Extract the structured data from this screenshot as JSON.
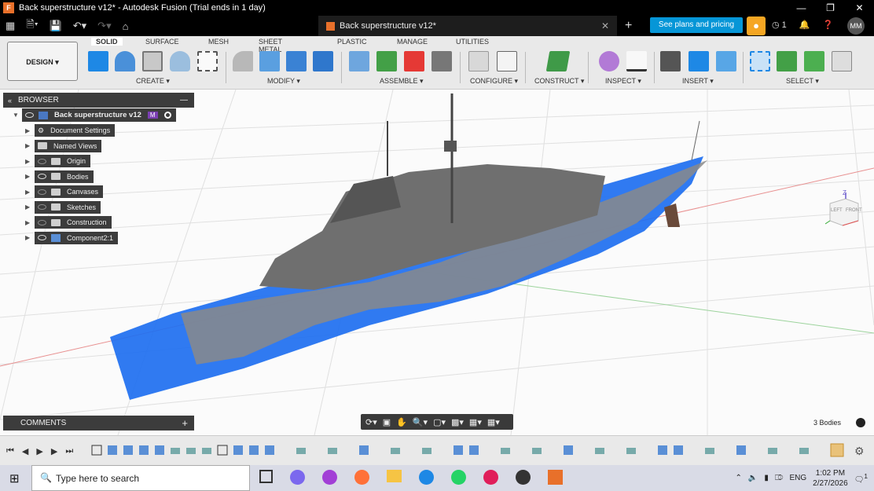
{
  "window": {
    "title": "Back superstructure v12* - Autodesk Fusion (Trial ends in 1 day)",
    "app_icon_label": "F"
  },
  "tabbar": {
    "doc_tab_title": "Back superstructure v12*",
    "plans_button": "See plans and pricing",
    "jobs_count": "1",
    "avatar_initials": "MM"
  },
  "ribbon": {
    "tabs": [
      "SOLID",
      "SURFACE",
      "MESH",
      "SHEET METAL",
      "PLASTIC",
      "MANAGE",
      "UTILITIES"
    ],
    "workspace": "DESIGN",
    "groups": [
      "CREATE",
      "MODIFY",
      "ASSEMBLE",
      "CONFIGURE",
      "CONSTRUCT",
      "INSPECT",
      "INSERT",
      "SELECT"
    ],
    "colors": {
      "accent": "#0696d7",
      "create_tool": "#1e88e5",
      "construct_tool": "#3f9a48"
    }
  },
  "browser": {
    "header": "BROWSER",
    "root": "Back superstructure v12",
    "root_badge": "M",
    "items": [
      {
        "label": "Document Settings",
        "icon": "gear-icon"
      },
      {
        "label": "Named Views",
        "icon": "folder-icon"
      },
      {
        "label": "Origin",
        "icon": "folder-icon"
      },
      {
        "label": "Bodies",
        "icon": "folder-icon"
      },
      {
        "label": "Canvases",
        "icon": "folder-icon"
      },
      {
        "label": "Sketches",
        "icon": "folder-icon"
      },
      {
        "label": "Construction",
        "icon": "folder-icon"
      },
      {
        "label": "Component2:1",
        "icon": "component-icon"
      }
    ]
  },
  "comments": {
    "label": "COMMENTS"
  },
  "viewport": {
    "bodies_count": "3 Bodies",
    "viewcube_face": "LEFT",
    "viewcube_side": "FRONT",
    "axis_label": "Z"
  },
  "taskbar": {
    "search_placeholder": "Type here to search",
    "language": "ENG",
    "time": "1:02 PM",
    "date": "2/27/2026",
    "notifications": "1"
  }
}
